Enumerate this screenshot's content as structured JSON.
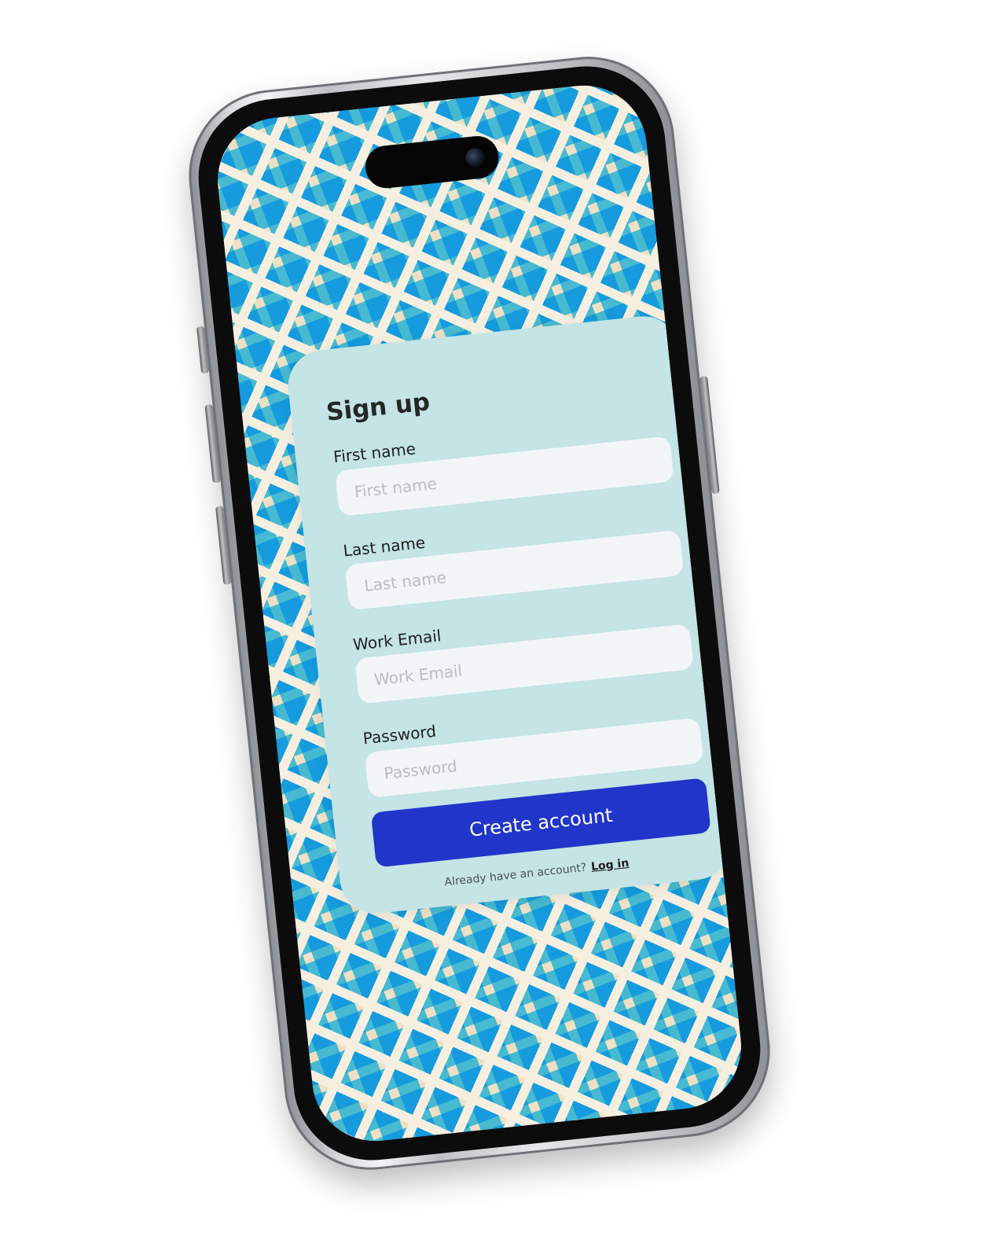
{
  "form": {
    "title": "Sign up",
    "first_name": {
      "label": "First name",
      "placeholder": "First name"
    },
    "last_name": {
      "label": "Last name",
      "placeholder": "Last name"
    },
    "work_email": {
      "label": "Work Email",
      "placeholder": "Work Email"
    },
    "password": {
      "label": "Password",
      "placeholder": "Password"
    },
    "submit_label": "Create account",
    "login_prompt": "Already have an account?",
    "login_link": "Log in"
  },
  "colors": {
    "card_background": "#c4e4e6",
    "button_primary": "#2135c8",
    "pattern_blue": "#4ac7ee",
    "pattern_cream": "#f6efe0",
    "input_background": "#f2f5f8"
  }
}
